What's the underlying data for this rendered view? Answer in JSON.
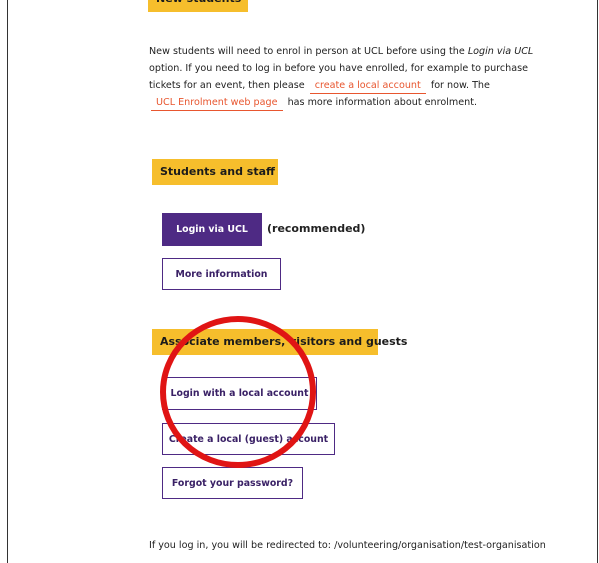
{
  "sections": {
    "new_students": {
      "heading": "New students",
      "text_1": "New students will need to enrol in person at UCL before using the",
      "text_em": "Login via UCL",
      "text_2": "option. If you need to log in before you have enrolled, for example to purchase tickets for an event, then please",
      "link_local": "create a local account",
      "text_3": "for now. The",
      "link_enrolment": "UCL Enrolment web page",
      "text_4": "has more information about enrolment."
    },
    "students_staff": {
      "heading": "Students and staff",
      "login_button": "Login via UCL",
      "recommended": "(recommended)",
      "more_button": "More information"
    },
    "associates": {
      "heading": "Associate members, visitors and guests",
      "local_login_button": "Login with a local account",
      "create_button": "Create a local (guest) account",
      "forgot_button": "Forgot your password?"
    }
  },
  "redirect": "If you log in, you will be redirected to: /volunteering/organisation/test-organisation",
  "annotation": {
    "shape": "circle",
    "color": "#e01414"
  },
  "colors": {
    "accent_yellow": "#f6be2c",
    "brand_purple": "#4e2a84",
    "link": "#e8562f"
  }
}
